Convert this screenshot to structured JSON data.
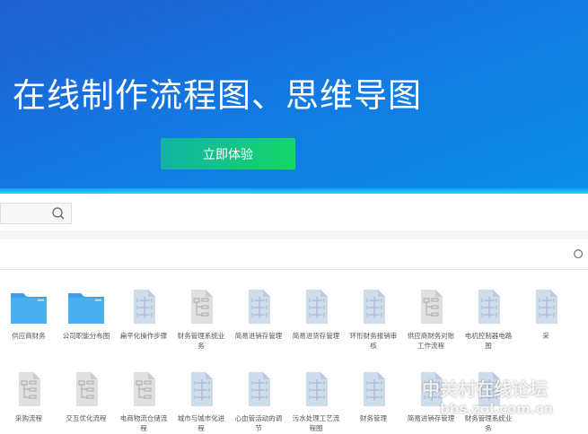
{
  "banner": {
    "title": "在线制作流程图、思维导图",
    "cta_label": "立即体验"
  },
  "search": {
    "placeholder": ""
  },
  "templates": [
    {
      "label": "供应商财务",
      "type": "folder"
    },
    {
      "label": "公司职能分布图",
      "type": "folder"
    },
    {
      "label": "扁平化操作步骤",
      "type": "mindmap"
    },
    {
      "label": "财务管理系统业务",
      "type": "flow"
    },
    {
      "label": "简易进销存管理",
      "type": "mindmap"
    },
    {
      "label": "简易进货存管理",
      "type": "mindmap"
    },
    {
      "label": "环形财务报销审核",
      "type": "mindmap"
    },
    {
      "label": "供应商财务对账工作流程",
      "type": "flow"
    },
    {
      "label": "电机控制器电路图",
      "type": "mindmap"
    },
    {
      "label": "采",
      "type": "mindmap"
    },
    {
      "label": "采购流程",
      "type": "flow"
    },
    {
      "label": "交互优化流程",
      "type": "flow"
    },
    {
      "label": "电商物流仓储流程",
      "type": "flow"
    },
    {
      "label": "城市与城市化进程",
      "type": "mindmap"
    },
    {
      "label": "心血管活动的调节",
      "type": "mindmap"
    },
    {
      "label": "污水处理工艺流程图",
      "type": "mindmap"
    },
    {
      "label": "财务管理",
      "type": "mindmap"
    },
    {
      "label": "简易进销存管理",
      "type": "mindmap"
    },
    {
      "label": "财务管理系统业务",
      "type": "mindmap"
    }
  ],
  "watermark": {
    "line1": "中关村在线论坛",
    "line2": "bbs.zol.com.cn"
  }
}
